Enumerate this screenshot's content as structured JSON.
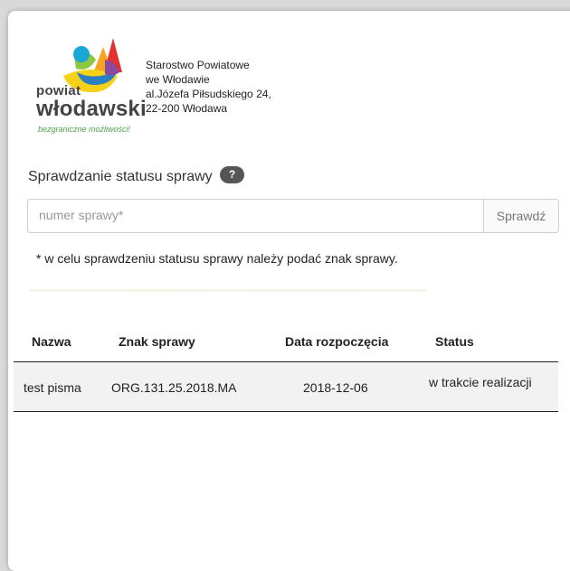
{
  "logo": {
    "line1": "powiat",
    "line2": "włodawski",
    "slogan": "bezgraniczne możliwości!"
  },
  "address": {
    "line1": "Starostwo Powiatowe",
    "line2": "we Włodawie",
    "line3": "al.Józefa Piłsudskiego 24,",
    "line4": "22-200 Włodawa"
  },
  "section": {
    "title": "Sprawdzanie statusu sprawy",
    "help_icon": "?"
  },
  "search": {
    "placeholder": "numer sprawy*",
    "value": "",
    "button_label": "Sprawdź"
  },
  "note": "* w celu sprawdzeniu statusu sprawy należy podać znak sprawy.",
  "table": {
    "headers": [
      "Nazwa",
      "Znak sprawy",
      "Data rozpoczęcia",
      "Status"
    ],
    "rows": [
      [
        "test pisma",
        "ORG.131.25.2018.MA",
        "2018-12-06",
        "w trakcie realizacji"
      ]
    ]
  }
}
